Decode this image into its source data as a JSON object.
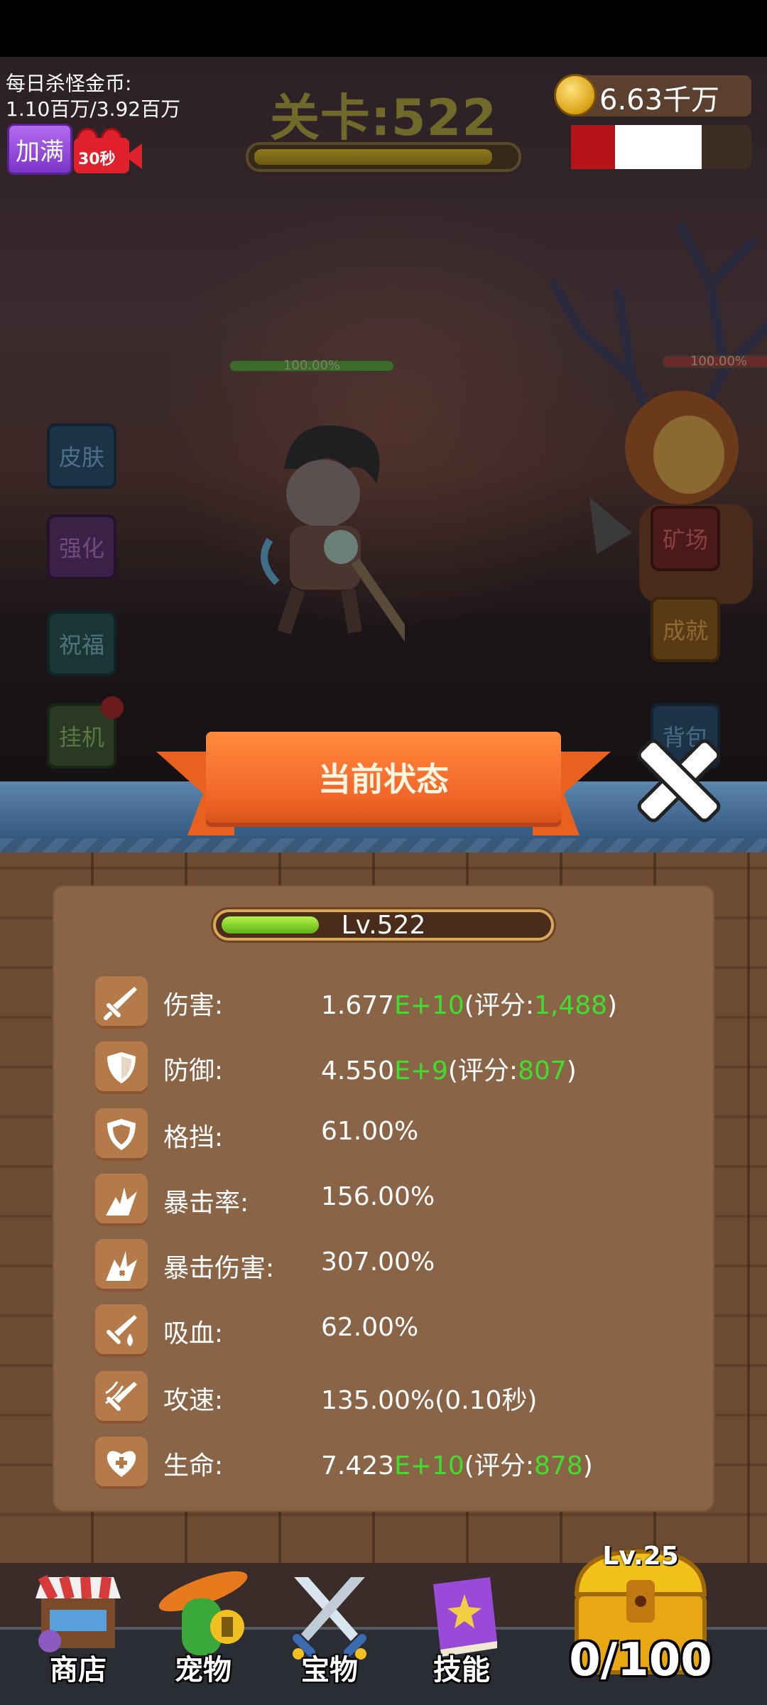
{
  "hud": {
    "daily_gold_label": "每日杀怪金币:",
    "daily_gold_value": "1.10百万/3.92百万",
    "fill_button": "加满",
    "video_timer": "30秒",
    "stage_title": "关卡:522",
    "stage_progress": 0.92,
    "coins": "6.63千万"
  },
  "battle": {
    "hero_hp": "100.00%",
    "enemy_hp": "100.00%"
  },
  "side_menu": {
    "left": [
      "皮肤",
      "强化",
      "祝福",
      "挂机"
    ],
    "right": [
      "矿场",
      "成就",
      "背包"
    ]
  },
  "panel": {
    "title": "当前状态",
    "level": "Lv.522",
    "level_progress": 0.3,
    "stats": [
      {
        "icon": "sword-icon",
        "label": "伤害:",
        "base": "1.677",
        "exp": "E+10",
        "score_prefix": "(评分:",
        "score": "1,488",
        "score_suffix": ")"
      },
      {
        "icon": "shield-icon",
        "label": "防御:",
        "base": "4.550",
        "exp": "E+9",
        "score_prefix": "(评分:",
        "score": "807",
        "score_suffix": ")"
      },
      {
        "icon": "block-shield-icon",
        "label": "格挡:",
        "value": "61.00%"
      },
      {
        "icon": "critical-rate-icon",
        "label": "暴击率:",
        "value": "156.00%"
      },
      {
        "icon": "critical-damage-icon",
        "label": "暴击伤害:",
        "value": "307.00%"
      },
      {
        "icon": "lifesteal-icon",
        "label": "吸血:",
        "value": "62.00%"
      },
      {
        "icon": "attack-speed-icon",
        "label": "攻速:",
        "value": "135.00%(0.10秒)"
      },
      {
        "icon": "heart-plus-icon",
        "label": "生命:",
        "base": "7.423",
        "exp": "E+10",
        "score_prefix": "(评分:",
        "score": "878",
        "score_suffix": ")"
      }
    ]
  },
  "bottom_nav": {
    "shop": "商店",
    "pet": "宠物",
    "treasure": "宝物",
    "skill": "技能",
    "chest_level": "Lv.25",
    "chest_count": "0/100"
  },
  "colors": {
    "highlight_green": "#3ee02d",
    "ribbon_orange": "#f2672a",
    "panel_brown": "#8a6446"
  }
}
